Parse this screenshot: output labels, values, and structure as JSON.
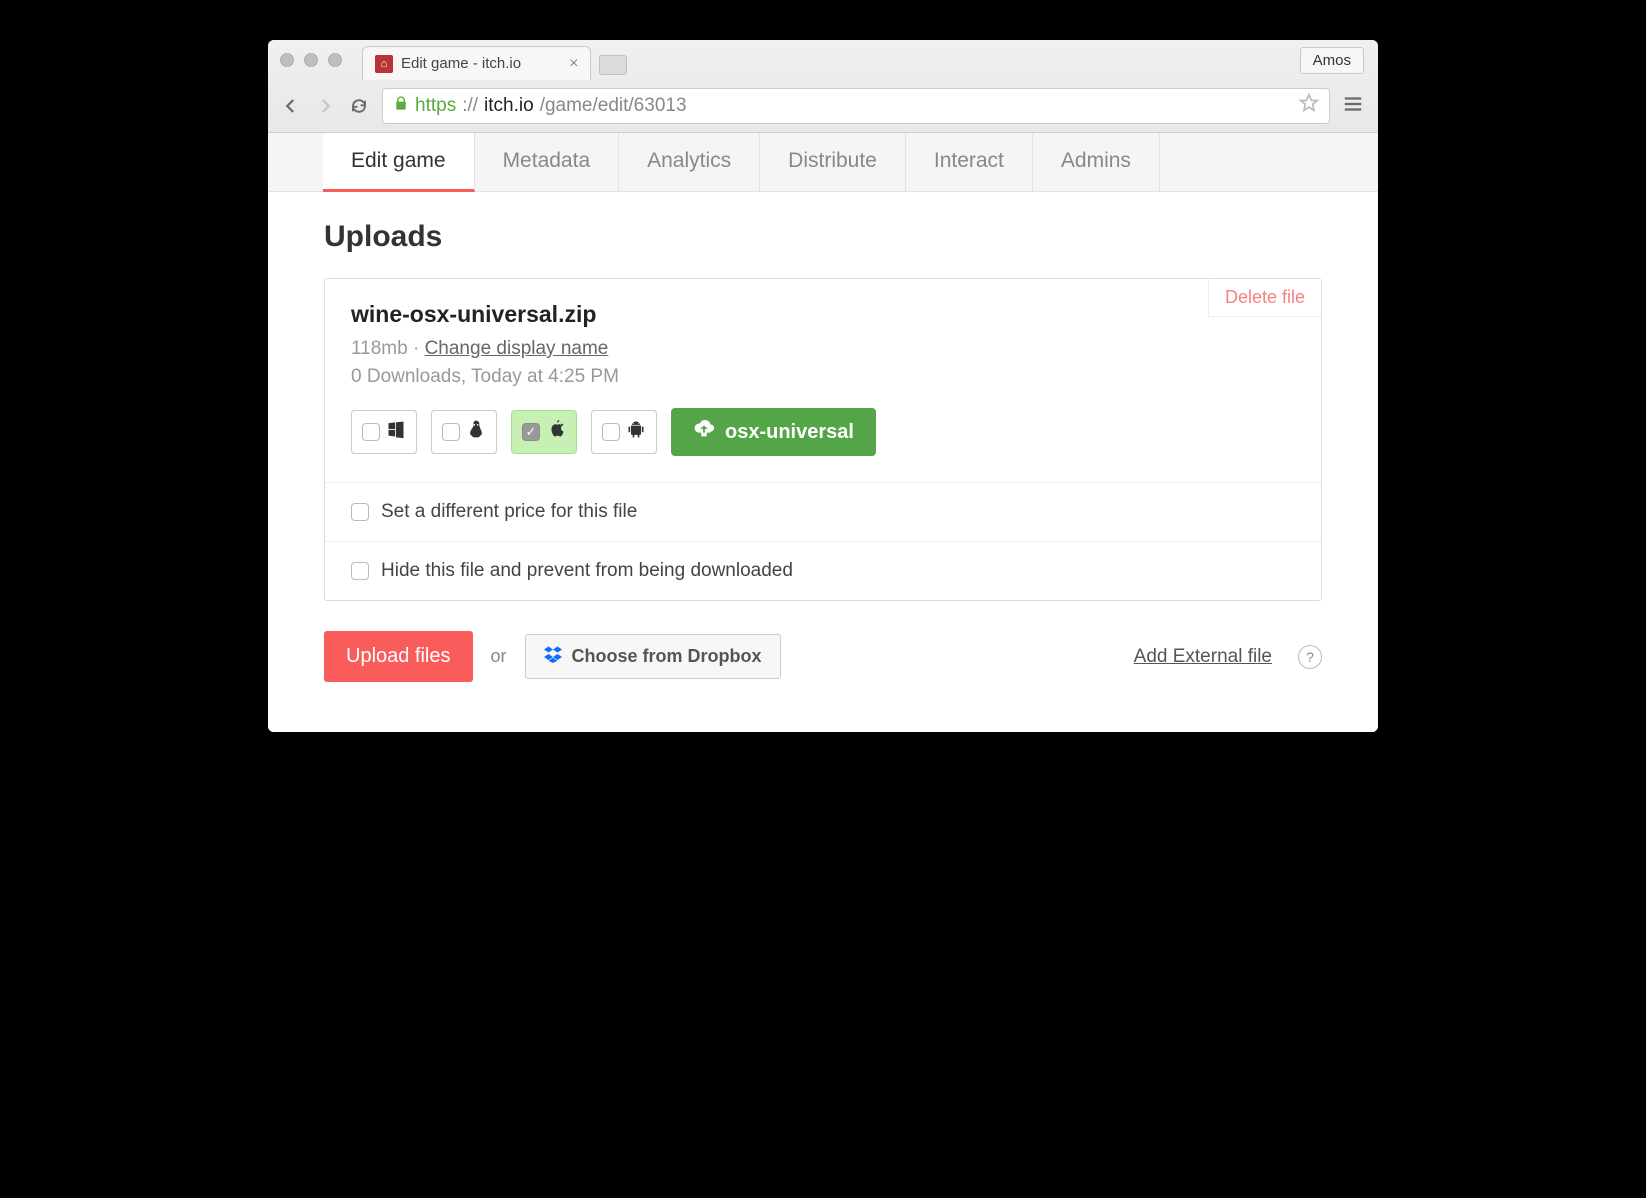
{
  "browser": {
    "tab_title": "Edit game - itch.io",
    "user_label": "Amos",
    "url_proto": "https",
    "url_sep": "://",
    "url_host": "itch.io",
    "url_path": "/game/edit/63013"
  },
  "tabs": [
    {
      "label": "Edit game",
      "active": true
    },
    {
      "label": "Metadata",
      "active": false
    },
    {
      "label": "Analytics",
      "active": false
    },
    {
      "label": "Distribute",
      "active": false
    },
    {
      "label": "Interact",
      "active": false
    },
    {
      "label": "Admins",
      "active": false
    }
  ],
  "section_title": "Uploads",
  "upload": {
    "filename": "wine-osx-universal.zip",
    "size": "118mb",
    "dot": " · ",
    "change_name_label": "Change display name",
    "stats": "0 Downloads, Today at 4:25 PM",
    "delete_label": "Delete file",
    "channel": "osx-universal",
    "platforms": {
      "windows": false,
      "linux": false,
      "mac": true,
      "android": false
    },
    "option_price": "Set a different price for this file",
    "option_hide": "Hide this file and prevent from being downloaded"
  },
  "actions": {
    "upload_label": "Upload files",
    "or": "or",
    "dropbox_label": "Choose from Dropbox",
    "external_label": "Add External file",
    "help": "?"
  }
}
